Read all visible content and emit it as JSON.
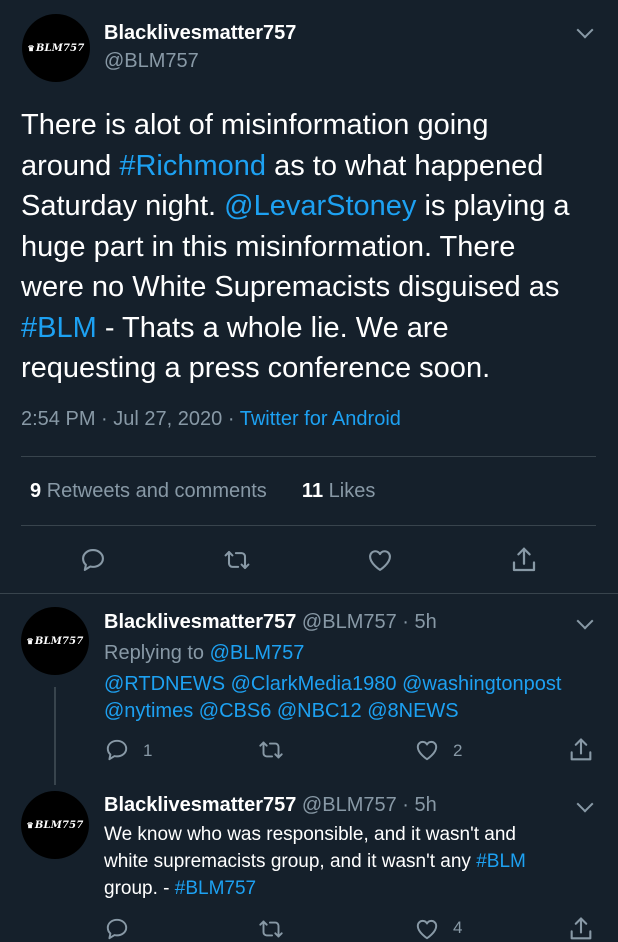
{
  "main_tweet": {
    "avatar_text": "BLM757",
    "display_name": "Blacklivesmatter757",
    "handle": "@BLM757",
    "text_lines": [
      [
        {
          "t": "There is alot of misinformation going",
          "link": false
        }
      ],
      [
        {
          "t": "around ",
          "link": false
        },
        {
          "t": "#Richmond",
          "link": true
        },
        {
          "t": " as to what happened",
          "link": false
        }
      ],
      [
        {
          "t": "Saturday night. ",
          "link": false
        },
        {
          "t": "@LevarStoney",
          "link": true
        },
        {
          "t": " is playing a",
          "link": false
        }
      ],
      [
        {
          "t": "huge part in this misinformation. There",
          "link": false
        }
      ],
      [
        {
          "t": "were no White Supremacists disguised as",
          "link": false
        }
      ],
      [
        {
          "t": "#BLM",
          "link": true
        },
        {
          "t": " - Thats a whole lie. We are",
          "link": false
        }
      ],
      [
        {
          "t": "requesting a press conference soon.",
          "link": false
        }
      ]
    ],
    "time": "2:54 PM",
    "date": "Jul 27, 2020",
    "source": "Twitter for Android",
    "retweets_count": "9",
    "retweets_label": "Retweets and comments",
    "likes_count": "11",
    "likes_label": "Likes"
  },
  "replies": [
    {
      "avatar_text": "BLM757",
      "display_name": "Blacklivesmatter757",
      "handle": "@BLM757",
      "age": "5h",
      "replying_prefix": "Replying to ",
      "replying_to": "@BLM757",
      "mentions_line1": "@RTDNEWS @ClarkMedia1980 @washingtonpost",
      "mentions_line2": "@nytimes @CBS6 @NBC12 @8NEWS",
      "reply_count": "1",
      "like_count": "2"
    },
    {
      "avatar_text": "BLM757",
      "display_name": "Blacklivesmatter757",
      "handle": "@BLM757",
      "age": "5h",
      "text_line1": "We know who was responsible, and it wasn't and",
      "text_line2": "white supremacists group, and it wasn't any ",
      "text_line2_tag": "#BLM",
      "text_line3": "group. - ",
      "text_line3_tag": "#BLM757",
      "like_count": "4"
    }
  ],
  "separator_dot": "·",
  "colors": {
    "background": "#15202b",
    "accent": "#1da1f2",
    "muted": "#8899a6",
    "divider": "#38444d"
  },
  "icons": [
    "reply-icon",
    "retweet-icon",
    "like-icon",
    "share-icon",
    "chevron-down-icon"
  ]
}
